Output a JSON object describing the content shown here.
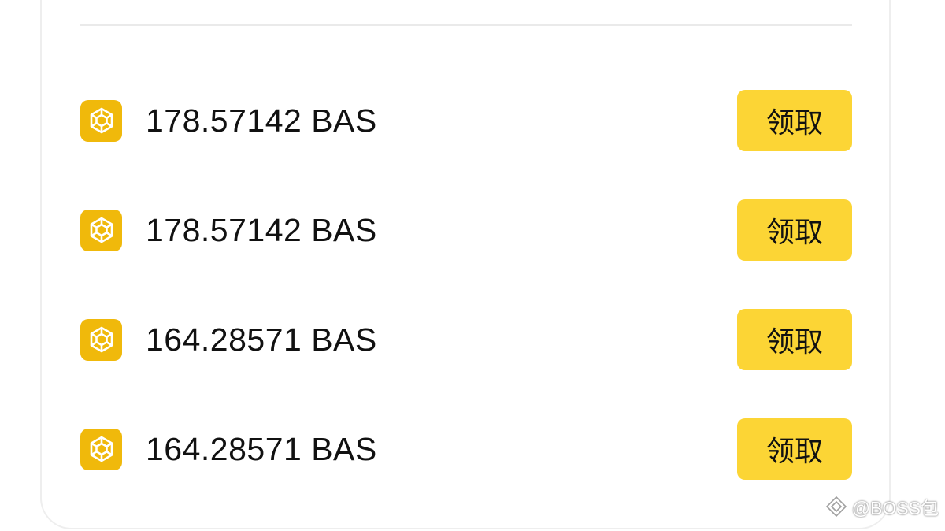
{
  "claims": [
    {
      "amount": "178.57142 BAS",
      "button_label": "领取"
    },
    {
      "amount": "178.57142 BAS",
      "button_label": "领取"
    },
    {
      "amount": "164.28571 BAS",
      "button_label": "领取"
    },
    {
      "amount": "164.28571 BAS",
      "button_label": "领取"
    }
  ],
  "icons": {
    "token": "bas-token-icon",
    "watermark": "diamond-logo-icon"
  },
  "watermark": {
    "text": "@BOSS包"
  },
  "colors": {
    "token_icon_bg": "#f0b90b",
    "button_bg": "#fcd535",
    "text": "#111111",
    "divider": "#eaeaea",
    "card_border": "#eeeeee"
  }
}
